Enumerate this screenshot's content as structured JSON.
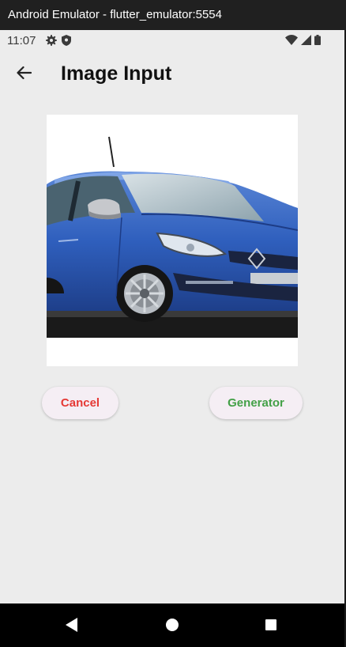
{
  "window": {
    "title": "Android Emulator - flutter_emulator:5554"
  },
  "status_bar": {
    "time": "11:07",
    "left_icons": [
      "settings-icon",
      "shield-icon"
    ],
    "right_icons": [
      "wifi-icon",
      "signal-icon",
      "battery-icon"
    ]
  },
  "app_bar": {
    "back_icon": "arrow-back-icon",
    "title": "Image Input"
  },
  "image": {
    "subject": "car-photo"
  },
  "buttons": {
    "cancel_label": "Cancel",
    "generator_label": "Generator"
  },
  "colors": {
    "cancel_text": "#e53935",
    "generator_text": "#43a047",
    "button_bg": "#f5eef4",
    "screen_bg": "#ececec"
  },
  "nav_bar": {
    "icons": [
      "nav-back-icon",
      "nav-home-icon",
      "nav-recents-icon"
    ]
  }
}
